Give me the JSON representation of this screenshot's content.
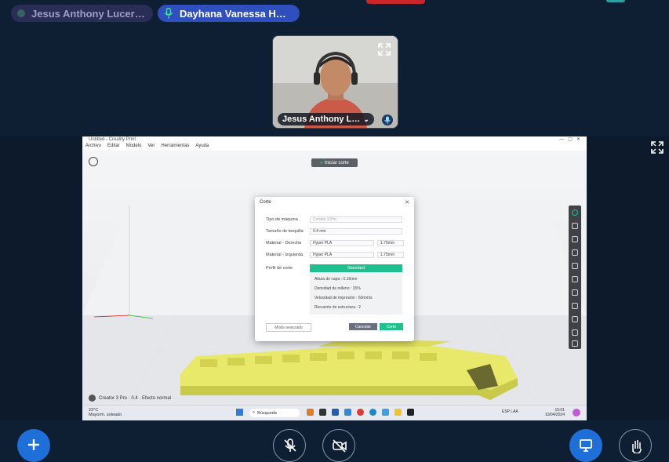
{
  "participants": {
    "chip_1": "Jesus Anthony Lucer…",
    "chip_2": "Dayhana Vanessa Hu…"
  },
  "video_tile": {
    "name": "Jesus Anthony L…",
    "caret": "⌄"
  },
  "app": {
    "window_title": "Untitled - Creality Print",
    "menu": [
      "Archivo",
      "Editar",
      "Modelo",
      "Ver",
      "Herramientas",
      "Ayuda"
    ],
    "slice_button": "Iniciar corte",
    "status_text": "Creator 3 Pro · 0.4 · Efecto normal"
  },
  "dialog": {
    "title": "Corte",
    "close": "✕",
    "rows": [
      {
        "label": "Tipo de máquina",
        "value": "Creator 3 Pro"
      },
      {
        "label": "Tamaño de boquilla",
        "value": "0.4 mm"
      },
      {
        "label": "Material - Derecha",
        "value": "Hyper PLA",
        "extra": "1.75mm"
      },
      {
        "label": "Material - Izquierda",
        "value": "Hyper PLA",
        "extra": "1.75mm"
      },
      {
        "label": "Perfil de corte",
        "value": ""
      }
    ],
    "profile": "Standard",
    "details": [
      "Altura de capa : 0.16mm",
      "Densidad de relleno : 15%",
      "Velocidad de impresión : 60mm/s",
      "Recuento de estructura : 2"
    ],
    "advanced": "Modo avanzado",
    "cancel": "Cancelar",
    "slice": "Corte"
  },
  "taskbar": {
    "weather_temp": "23°C",
    "weather_desc": "Mayorm. soleado",
    "search": "Búsqueda",
    "lang": "ESP LAA",
    "time": "15:01",
    "date": "10/04/2024"
  },
  "colors": {
    "background": "#0f1f33",
    "accent_blue": "#2f4fbf",
    "green": "#1fc08e",
    "model_yellow": "#e8e86a"
  }
}
